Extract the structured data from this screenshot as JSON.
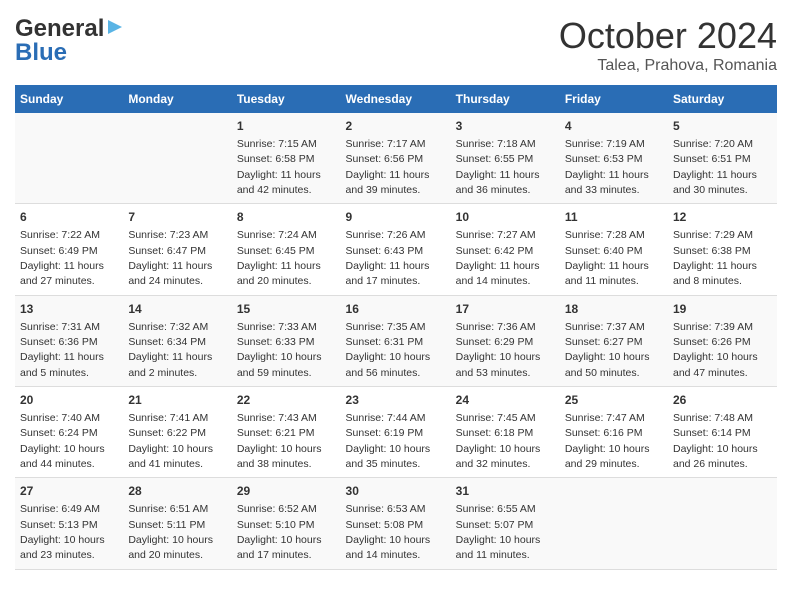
{
  "logo": {
    "line1": "General",
    "line2": "Blue"
  },
  "title": "October 2024",
  "subtitle": "Talea, Prahova, Romania",
  "weekdays": [
    "Sunday",
    "Monday",
    "Tuesday",
    "Wednesday",
    "Thursday",
    "Friday",
    "Saturday"
  ],
  "weeks": [
    [
      {
        "day": "",
        "sunrise": "",
        "sunset": "",
        "daylight": ""
      },
      {
        "day": "",
        "sunrise": "",
        "sunset": "",
        "daylight": ""
      },
      {
        "day": "1",
        "sunrise": "Sunrise: 7:15 AM",
        "sunset": "Sunset: 6:58 PM",
        "daylight": "Daylight: 11 hours and 42 minutes."
      },
      {
        "day": "2",
        "sunrise": "Sunrise: 7:17 AM",
        "sunset": "Sunset: 6:56 PM",
        "daylight": "Daylight: 11 hours and 39 minutes."
      },
      {
        "day": "3",
        "sunrise": "Sunrise: 7:18 AM",
        "sunset": "Sunset: 6:55 PM",
        "daylight": "Daylight: 11 hours and 36 minutes."
      },
      {
        "day": "4",
        "sunrise": "Sunrise: 7:19 AM",
        "sunset": "Sunset: 6:53 PM",
        "daylight": "Daylight: 11 hours and 33 minutes."
      },
      {
        "day": "5",
        "sunrise": "Sunrise: 7:20 AM",
        "sunset": "Sunset: 6:51 PM",
        "daylight": "Daylight: 11 hours and 30 minutes."
      }
    ],
    [
      {
        "day": "6",
        "sunrise": "Sunrise: 7:22 AM",
        "sunset": "Sunset: 6:49 PM",
        "daylight": "Daylight: 11 hours and 27 minutes."
      },
      {
        "day": "7",
        "sunrise": "Sunrise: 7:23 AM",
        "sunset": "Sunset: 6:47 PM",
        "daylight": "Daylight: 11 hours and 24 minutes."
      },
      {
        "day": "8",
        "sunrise": "Sunrise: 7:24 AM",
        "sunset": "Sunset: 6:45 PM",
        "daylight": "Daylight: 11 hours and 20 minutes."
      },
      {
        "day": "9",
        "sunrise": "Sunrise: 7:26 AM",
        "sunset": "Sunset: 6:43 PM",
        "daylight": "Daylight: 11 hours and 17 minutes."
      },
      {
        "day": "10",
        "sunrise": "Sunrise: 7:27 AM",
        "sunset": "Sunset: 6:42 PM",
        "daylight": "Daylight: 11 hours and 14 minutes."
      },
      {
        "day": "11",
        "sunrise": "Sunrise: 7:28 AM",
        "sunset": "Sunset: 6:40 PM",
        "daylight": "Daylight: 11 hours and 11 minutes."
      },
      {
        "day": "12",
        "sunrise": "Sunrise: 7:29 AM",
        "sunset": "Sunset: 6:38 PM",
        "daylight": "Daylight: 11 hours and 8 minutes."
      }
    ],
    [
      {
        "day": "13",
        "sunrise": "Sunrise: 7:31 AM",
        "sunset": "Sunset: 6:36 PM",
        "daylight": "Daylight: 11 hours and 5 minutes."
      },
      {
        "day": "14",
        "sunrise": "Sunrise: 7:32 AM",
        "sunset": "Sunset: 6:34 PM",
        "daylight": "Daylight: 11 hours and 2 minutes."
      },
      {
        "day": "15",
        "sunrise": "Sunrise: 7:33 AM",
        "sunset": "Sunset: 6:33 PM",
        "daylight": "Daylight: 10 hours and 59 minutes."
      },
      {
        "day": "16",
        "sunrise": "Sunrise: 7:35 AM",
        "sunset": "Sunset: 6:31 PM",
        "daylight": "Daylight: 10 hours and 56 minutes."
      },
      {
        "day": "17",
        "sunrise": "Sunrise: 7:36 AM",
        "sunset": "Sunset: 6:29 PM",
        "daylight": "Daylight: 10 hours and 53 minutes."
      },
      {
        "day": "18",
        "sunrise": "Sunrise: 7:37 AM",
        "sunset": "Sunset: 6:27 PM",
        "daylight": "Daylight: 10 hours and 50 minutes."
      },
      {
        "day": "19",
        "sunrise": "Sunrise: 7:39 AM",
        "sunset": "Sunset: 6:26 PM",
        "daylight": "Daylight: 10 hours and 47 minutes."
      }
    ],
    [
      {
        "day": "20",
        "sunrise": "Sunrise: 7:40 AM",
        "sunset": "Sunset: 6:24 PM",
        "daylight": "Daylight: 10 hours and 44 minutes."
      },
      {
        "day": "21",
        "sunrise": "Sunrise: 7:41 AM",
        "sunset": "Sunset: 6:22 PM",
        "daylight": "Daylight: 10 hours and 41 minutes."
      },
      {
        "day": "22",
        "sunrise": "Sunrise: 7:43 AM",
        "sunset": "Sunset: 6:21 PM",
        "daylight": "Daylight: 10 hours and 38 minutes."
      },
      {
        "day": "23",
        "sunrise": "Sunrise: 7:44 AM",
        "sunset": "Sunset: 6:19 PM",
        "daylight": "Daylight: 10 hours and 35 minutes."
      },
      {
        "day": "24",
        "sunrise": "Sunrise: 7:45 AM",
        "sunset": "Sunset: 6:18 PM",
        "daylight": "Daylight: 10 hours and 32 minutes."
      },
      {
        "day": "25",
        "sunrise": "Sunrise: 7:47 AM",
        "sunset": "Sunset: 6:16 PM",
        "daylight": "Daylight: 10 hours and 29 minutes."
      },
      {
        "day": "26",
        "sunrise": "Sunrise: 7:48 AM",
        "sunset": "Sunset: 6:14 PM",
        "daylight": "Daylight: 10 hours and 26 minutes."
      }
    ],
    [
      {
        "day": "27",
        "sunrise": "Sunrise: 6:49 AM",
        "sunset": "Sunset: 5:13 PM",
        "daylight": "Daylight: 10 hours and 23 minutes."
      },
      {
        "day": "28",
        "sunrise": "Sunrise: 6:51 AM",
        "sunset": "Sunset: 5:11 PM",
        "daylight": "Daylight: 10 hours and 20 minutes."
      },
      {
        "day": "29",
        "sunrise": "Sunrise: 6:52 AM",
        "sunset": "Sunset: 5:10 PM",
        "daylight": "Daylight: 10 hours and 17 minutes."
      },
      {
        "day": "30",
        "sunrise": "Sunrise: 6:53 AM",
        "sunset": "Sunset: 5:08 PM",
        "daylight": "Daylight: 10 hours and 14 minutes."
      },
      {
        "day": "31",
        "sunrise": "Sunrise: 6:55 AM",
        "sunset": "Sunset: 5:07 PM",
        "daylight": "Daylight: 10 hours and 11 minutes."
      },
      {
        "day": "",
        "sunrise": "",
        "sunset": "",
        "daylight": ""
      },
      {
        "day": "",
        "sunrise": "",
        "sunset": "",
        "daylight": ""
      }
    ]
  ]
}
